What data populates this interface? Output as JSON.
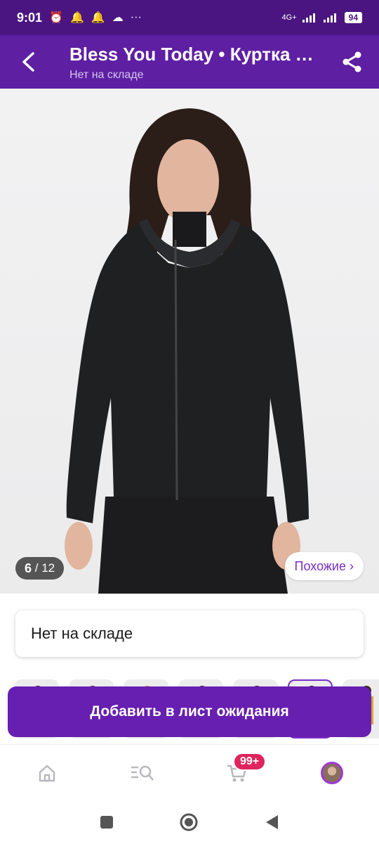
{
  "status_bar": {
    "time": "9:01",
    "network": "4G+",
    "battery": "94"
  },
  "header": {
    "title": "Bless You Today • Куртка …",
    "subtitle": "Нет на складе"
  },
  "gallery": {
    "current": "6",
    "separator": " / ",
    "total": "12",
    "similar_label": "Похожие ›"
  },
  "stock_status": "Нет на складе",
  "action_button": "Добавить в лист ожидания",
  "bottom_nav": {
    "cart_badge": "99+"
  },
  "colors": {
    "accent": "#661fb0",
    "header": "#5e1fa3",
    "status_bar": "#4a1580",
    "badge": "#e0245e"
  }
}
